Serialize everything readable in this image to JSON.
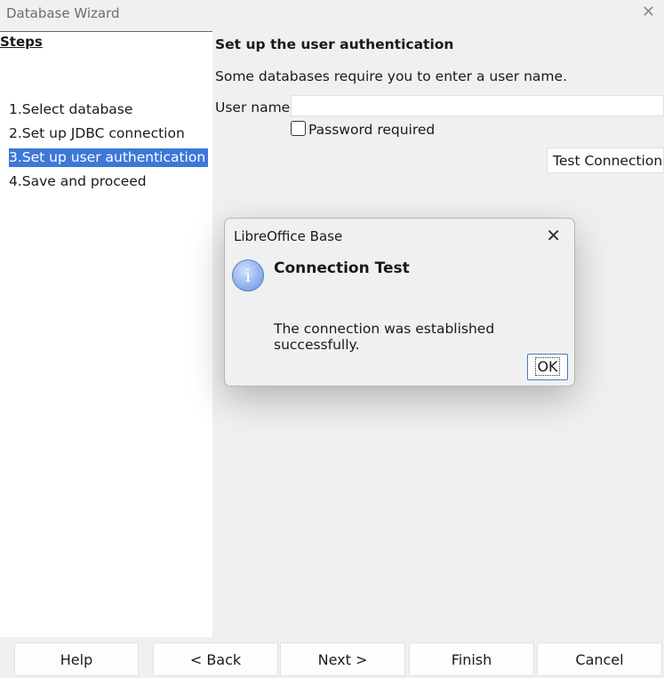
{
  "window": {
    "title": "Database Wizard"
  },
  "steps": {
    "header": "Steps",
    "items": [
      {
        "label": "1.Select database"
      },
      {
        "label": "2.Set up JDBC connection"
      },
      {
        "label": "3.Set up user authentication",
        "selected": true
      },
      {
        "label": "4.Save and proceed"
      }
    ]
  },
  "content": {
    "title": "Set up the user authentication",
    "info": "Some databases require you to enter a user name.",
    "user_name_label": "User name",
    "user_name_value": "",
    "password_required_label": "Password required",
    "password_required_checked": false,
    "test_connection_label": "Test Connection"
  },
  "dialog": {
    "title": "LibreOffice Base",
    "heading": "Connection Test",
    "message": "The connection was established successfully.",
    "ok_label": "OK",
    "icon": "info-icon",
    "icon_glyph": "i"
  },
  "buttons": {
    "help": "Help",
    "back": "< Back",
    "next": "Next >",
    "finish": "Finish",
    "cancel": "Cancel"
  },
  "colors": {
    "selection": "#3c78d8",
    "ok_border": "#4a78c2"
  }
}
